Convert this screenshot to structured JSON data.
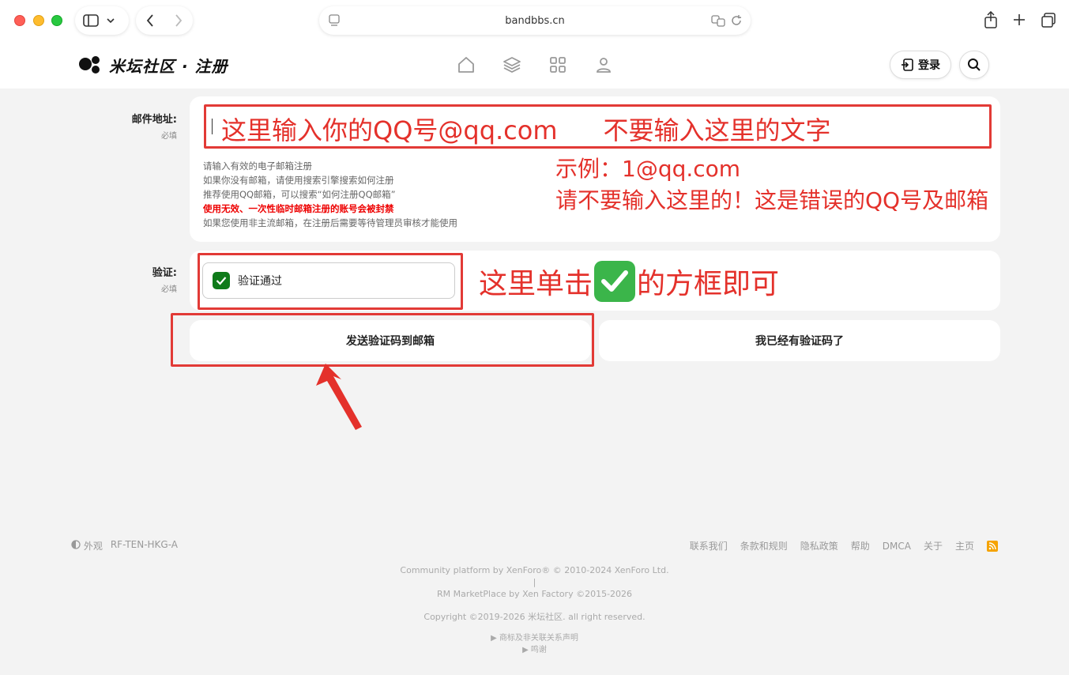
{
  "browser": {
    "url": "bandbbs.cn"
  },
  "site": {
    "logo_text": "米坛社区 · 注册",
    "login_label": "登录"
  },
  "email_row": {
    "label": "邮件地址:",
    "required": "必填",
    "overlay_a": "这里输入你的QQ号@qq.com",
    "overlay_b": "不要输入这里的文字",
    "help": [
      "请输入有效的电子邮箱注册",
      "如果你没有邮箱，请使用搜索引擎搜索如何注册",
      "推荐使用QQ邮箱，可以搜索“如何注册QQ邮箱”",
      "使用无效、一次性临时邮箱注册的账号会被封禁",
      "如果您使用非主流邮箱，在注册后需要等待管理员审核才能使用"
    ],
    "example_note_1": "示例：1@qq.com",
    "example_note_2": "请不要输入这里的！这是错误的QQ号及邮箱"
  },
  "verify_row": {
    "label": "验证:",
    "required": "必填",
    "status": "验证通过",
    "note_before": "这里单击",
    "note_after": "的方框即可"
  },
  "buttons": {
    "send_code": "发送验证码到邮箱",
    "have_code": "我已经有验证码了"
  },
  "footer": {
    "style": "外观",
    "server": "RF-TEN-HKG-A",
    "links": [
      "联系我们",
      "条款和规则",
      "隐私政策",
      "帮助",
      "DMCA",
      "关于",
      "主页"
    ],
    "line1": "Community platform by XenForo® © 2010-2024 XenForo Ltd.",
    "line2": "|",
    "line3": "RM MarketPlace by Xen Factory ©2015-2026",
    "line4": "Copyright ©2019-2026 米坛社区. all right reserved.",
    "line5": "▶ 商标及非关联关系声明",
    "line6": "▶ 鸣谢"
  },
  "colors": {
    "annotation_red": "#e4312b",
    "checkbox_green": "#0f7b1a",
    "rss_orange": "#f5a300"
  }
}
